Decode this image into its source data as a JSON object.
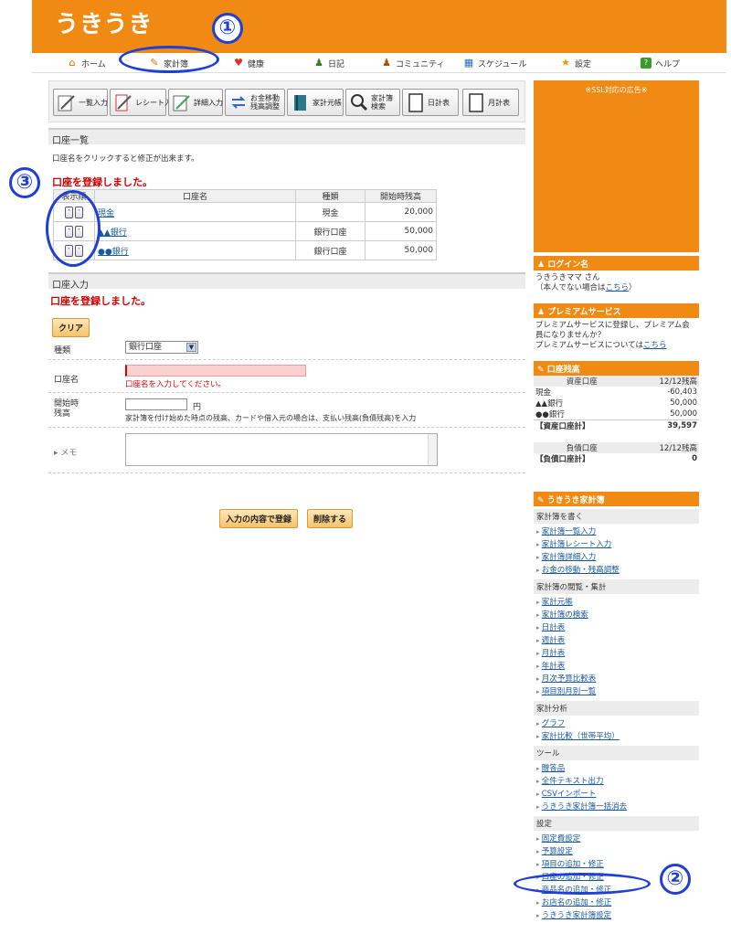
{
  "logo": "うきうき",
  "nav": [
    {
      "label": "ホーム",
      "icon": "home-icon"
    },
    {
      "label": "家計簿",
      "icon": "pencil-icon"
    },
    {
      "label": "健康",
      "icon": "heart-icon"
    },
    {
      "label": "日記",
      "icon": "person-icon"
    },
    {
      "label": "コミュニティ",
      "icon": "community-icon"
    },
    {
      "label": "スケジュール",
      "icon": "calendar-icon"
    },
    {
      "label": "設定",
      "icon": "star-icon"
    },
    {
      "label": "ヘルプ",
      "icon": "help-icon"
    }
  ],
  "toolbar": [
    "一覧入力",
    "レシート入力",
    "詳細入力",
    "お金移動\n残高調整",
    "家計元帳",
    "家計簿\n検索",
    "日計表",
    "月計表"
  ],
  "accounts_section": {
    "title": "口座一覧",
    "hint": "口座名をクリックすると修正が出来ます。",
    "message": "口座を登録しました。",
    "headers": [
      "表示順",
      "口座名",
      "種類",
      "開始時残高"
    ],
    "rows": [
      {
        "name": "現金",
        "type": "現金",
        "balance": "20,000"
      },
      {
        "name": "▲▲銀行",
        "type": "銀行口座",
        "balance": "50,000"
      },
      {
        "name": "●●銀行",
        "type": "銀行口座",
        "balance": "50,000"
      }
    ]
  },
  "input_section": {
    "title": "口座入力",
    "message": "口座を登録しました。",
    "clear": "クリア",
    "type_label": "種類",
    "type_value": "銀行口座",
    "name_label": "口座名",
    "name_error": "口座名を入力してください。",
    "start_label1": "開始時",
    "start_label2": "残高",
    "yen": "円",
    "start_hint": "家計簿を付け始めた時点の残高、カードや借入元の場合は、支払い残高(負債残高)を入力",
    "memo_label": "メモ",
    "submit": "入力の内容で登録",
    "delete": "削除する"
  },
  "side": {
    "ad": "※SSL対応の広告※",
    "login_title": "ログイン名",
    "login_name": "うきうきママ さん",
    "login_note": "（本人でない場合は",
    "login_link": "こちら",
    "login_close": "）",
    "premium_title": "プレミアムサービス",
    "premium_text": "プレミアムサービスに登録し、プレミアム会員になりませんか？",
    "premium_text2": "プレミアムサービスについては",
    "premium_link": "こちら",
    "balance_title": "口座残高",
    "asset_head": "資産口座",
    "asset_count": "12/12残高",
    "assets": [
      [
        "現金",
        "-60,403"
      ],
      [
        "▲▲銀行",
        "50,000"
      ],
      [
        "●●銀行",
        "50,000"
      ]
    ],
    "asset_total_label": "【資産口座計】",
    "asset_total": "39,597",
    "debt_head": "負債口座",
    "debt_count": "12/12残高",
    "debt_total_label": "【負債口座計】",
    "debt_total": "0",
    "menu_title": "うきうき家計簿",
    "menu": [
      {
        "cat": "家計簿を書く",
        "items": [
          "家計簿一覧入力",
          "家計簿レシート入力",
          "家計簿詳細入力",
          "お金の移動・残高調整"
        ]
      },
      {
        "cat": "家計簿の閲覧・集計",
        "items": [
          "家計元帳",
          "家計簿の検索",
          "日計表",
          "週計表",
          "月計表",
          "年計表",
          "月次予算比較表",
          "項目別月別一覧"
        ]
      },
      {
        "cat": "家計分析",
        "items": [
          "グラフ",
          "家計比較（世帯平均）"
        ]
      },
      {
        "cat": "ツール",
        "items": [
          "贈答品",
          "全件テキスト出力",
          "CSVインポート",
          "うきうき家計簿一括消去"
        ]
      },
      {
        "cat": "設定",
        "items": [
          "固定費設定",
          "予算設定",
          "項目の追加・修正",
          "口座の追加・修正",
          "商品名の追加・修正",
          "お店名の追加・修正",
          "うきうき家計簿設定"
        ]
      }
    ]
  },
  "annotations": [
    "①",
    "②",
    "③"
  ]
}
